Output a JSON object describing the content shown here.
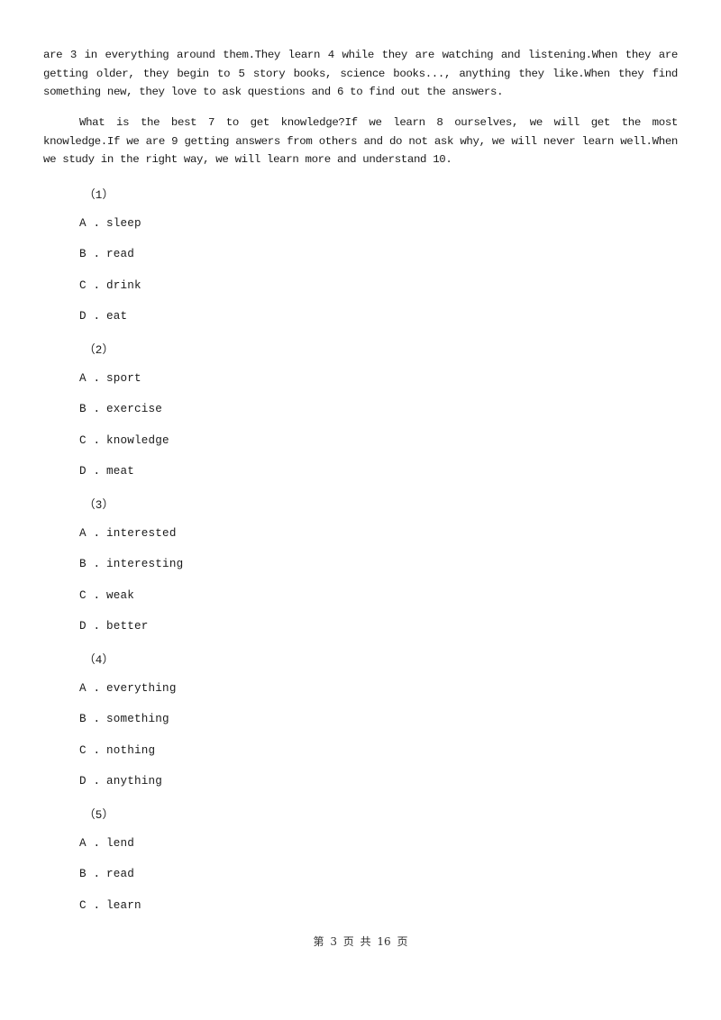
{
  "passage": {
    "paragraph_1": "are 3 in everything around them.They learn 4 while they are watching and listening.When they are getting older, they begin to 5 story books, science books..., anything they like.When they find something new, they love to ask questions and 6 to find out the answers.",
    "paragraph_2": "What is the best 7 to get knowledge?If we learn 8 ourselves, we will get the most knowledge.If we are 9 getting answers from others and do not ask why, we will never learn well.When we study in the right way, we will learn more and understand 10."
  },
  "questions": [
    {
      "label": "（1）",
      "options": [
        {
          "letter": "A .",
          "text": "sleep"
        },
        {
          "letter": "B .",
          "text": "read"
        },
        {
          "letter": "C .",
          "text": "drink"
        },
        {
          "letter": "D .",
          "text": "eat"
        }
      ]
    },
    {
      "label": "（2）",
      "options": [
        {
          "letter": "A .",
          "text": "sport"
        },
        {
          "letter": "B .",
          "text": "exercise"
        },
        {
          "letter": "C .",
          "text": "knowledge"
        },
        {
          "letter": "D .",
          "text": "meat"
        }
      ]
    },
    {
      "label": "（3）",
      "options": [
        {
          "letter": "A .",
          "text": "interested"
        },
        {
          "letter": "B .",
          "text": "interesting"
        },
        {
          "letter": "C .",
          "text": "weak"
        },
        {
          "letter": "D .",
          "text": "better"
        }
      ]
    },
    {
      "label": "（4）",
      "options": [
        {
          "letter": "A .",
          "text": "everything"
        },
        {
          "letter": "B .",
          "text": "something"
        },
        {
          "letter": "C .",
          "text": "nothing"
        },
        {
          "letter": "D .",
          "text": "anything"
        }
      ]
    },
    {
      "label": "（5）",
      "options": [
        {
          "letter": "A .",
          "text": "lend"
        },
        {
          "letter": "B .",
          "text": "read"
        },
        {
          "letter": "C .",
          "text": "learn"
        }
      ]
    }
  ],
  "footer": {
    "page_indicator": "第 3 页 共 16 页"
  }
}
